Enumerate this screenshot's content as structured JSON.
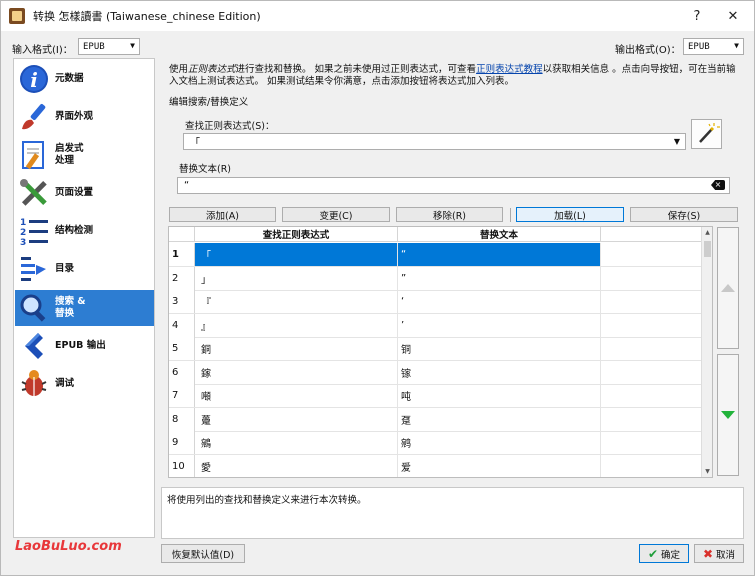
{
  "window": {
    "title": "转换 怎樣讀書 (Taiwanese_chinese Edition)",
    "help_glyph": "?",
    "close_glyph": "✕"
  },
  "formats": {
    "input_label": "输入格式(I)：",
    "input_value": "EPUB",
    "output_label": "输出格式(O)：",
    "output_value": "EPUB"
  },
  "sidebar": {
    "items": [
      {
        "label": "元数据",
        "icon": "info-icon"
      },
      {
        "label": "界面外观",
        "icon": "paintbrush-icon"
      },
      {
        "label": "启发式\n处理",
        "icon": "document-wand-icon"
      },
      {
        "label": "页面设置",
        "icon": "tools-icon"
      },
      {
        "label": "结构检测",
        "icon": "numbered-list-icon"
      },
      {
        "label": "目录",
        "icon": "toc-icon"
      },
      {
        "label": "搜索 &\n替换",
        "icon": "magnifier-icon"
      },
      {
        "label": "EPUB 输出",
        "icon": "chevron-left-icon"
      },
      {
        "label": "调试",
        "icon": "bug-icon"
      }
    ],
    "selected_index": 6
  },
  "help": {
    "part1": "使用",
    "italic": "正则表达式",
    "part2": "进行查找和替换。 如果之前未使用过正则表达式，可查看",
    "link": "正则表达式教程",
    "part3": "以获取相关信息 。点击向导按钮，可在当前输入文档上测试表达式。 如果测试结果令你满意，点击添加按钮将表达式加入列表。"
  },
  "editor": {
    "group_label": "编辑搜索/替换定义",
    "find_label": "查找正则表达式(S)：",
    "find_value": "「",
    "replace_label": "替换文本(R)",
    "replace_value": "“"
  },
  "actions": {
    "add": "添加(A)",
    "change": "变更(C)",
    "remove": "移除(R)",
    "load": "加载(L)",
    "save": "保存(S)"
  },
  "table": {
    "headers": [
      "查找正则表达式",
      "替换文本"
    ],
    "rows": [
      {
        "n": "1",
        "find": "「",
        "replace": "“"
      },
      {
        "n": "2",
        "find": "」",
        "replace": "”"
      },
      {
        "n": "3",
        "find": "『",
        "replace": "‘"
      },
      {
        "n": "4",
        "find": "』",
        "replace": "’"
      },
      {
        "n": "5",
        "find": "銅",
        "replace": "铜"
      },
      {
        "n": "6",
        "find": "鎵",
        "replace": "镓"
      },
      {
        "n": "7",
        "find": "噸",
        "replace": "吨"
      },
      {
        "n": "8",
        "find": "躉",
        "replace": "趸"
      },
      {
        "n": "9",
        "find": "鵷",
        "replace": "鹓"
      },
      {
        "n": "10",
        "find": "愛",
        "replace": "爱"
      }
    ],
    "selected_row": 0
  },
  "message": "将使用列出的查找和替换定义来进行本次转换。",
  "watermark": "LaoBuLuo.com",
  "footer": {
    "restore": "恢复默认值(D)",
    "ok": "确定",
    "cancel": "取消"
  },
  "colors": {
    "accent": "#0078d7",
    "nav_selected": "#2d7dd2",
    "ok_check": "#1f9e3a",
    "cancel_x": "#d9302b",
    "down_arrow": "#22b33b"
  }
}
